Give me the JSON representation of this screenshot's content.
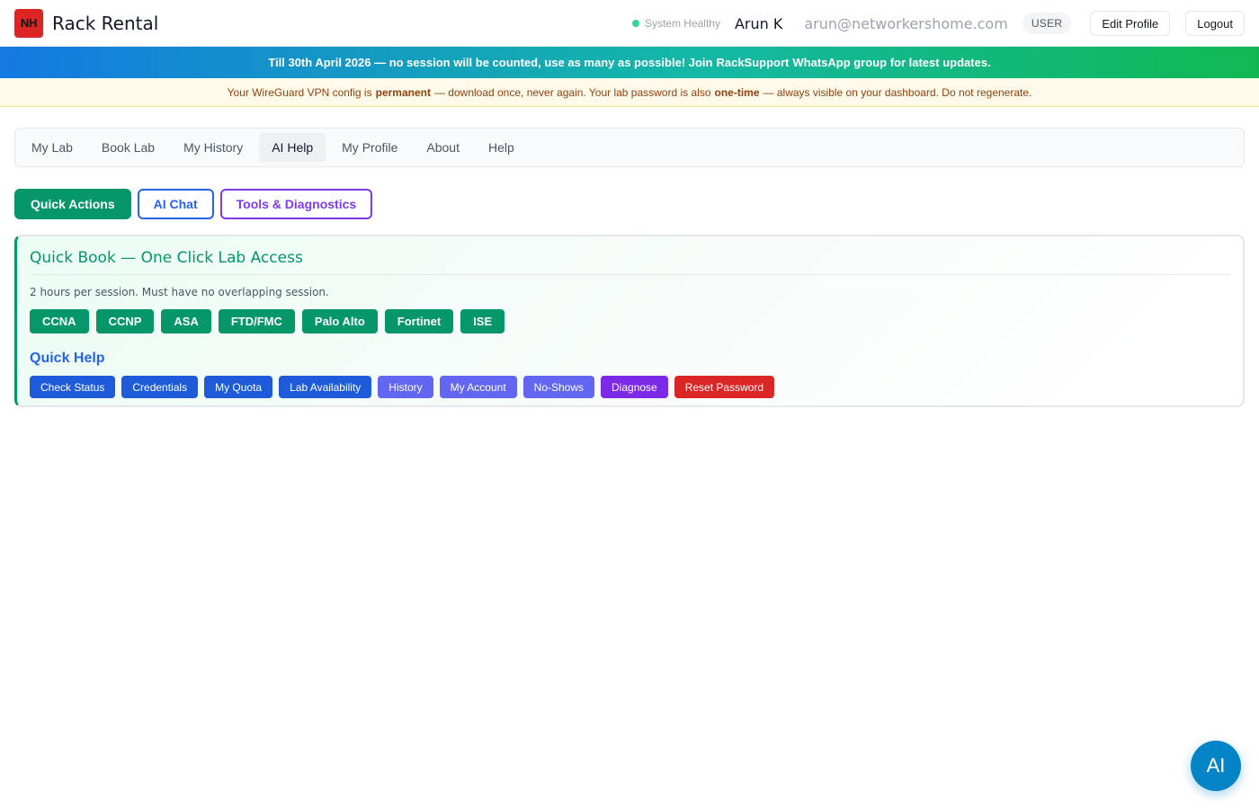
{
  "header": {
    "logo_text": "NH",
    "app_title": "Rack Rental",
    "status_text": "System Healthy",
    "user_name": "Arun K",
    "user_email": "arun@networkershome.com",
    "role": "USER",
    "edit_profile_label": "Edit Profile",
    "logout_label": "Logout"
  },
  "promo_banner": {
    "text_before": "Till 30th April 2026 — no session will be counted, use as many as possible! Join",
    "bold": "RackSupport",
    "text_after": "WhatsApp group for latest updates."
  },
  "notice_banner": {
    "part1": "Your WireGuard VPN config is",
    "bold1": "permanent",
    "part2": "— download once, never again. Your lab password is also",
    "bold2": "one-time",
    "part3": "— always visible on your dashboard. Do not regenerate."
  },
  "nav": {
    "tabs": [
      {
        "label": "My Lab"
      },
      {
        "label": "Book Lab"
      },
      {
        "label": "My History"
      },
      {
        "label": "AI Help",
        "active": true
      },
      {
        "label": "My Profile"
      },
      {
        "label": "About"
      },
      {
        "label": "Help"
      }
    ]
  },
  "subtabs": {
    "quick_actions": "Quick Actions",
    "ai_chat": "AI Chat",
    "tools": "Tools & Diagnostics"
  },
  "quick_book": {
    "title": "Quick Book — One Click Lab Access",
    "subtitle": "2 hours per session. Must have no overlapping session.",
    "labs": [
      "CCNA",
      "CCNP",
      "ASA",
      "FTD/FMC",
      "Palo Alto",
      "Fortinet",
      "ISE"
    ]
  },
  "quick_help": {
    "title": "Quick Help",
    "buttons": [
      {
        "label": "Check Status",
        "color": "#1d5bdb"
      },
      {
        "label": "Credentials",
        "color": "#1d5bdb"
      },
      {
        "label": "My Quota",
        "color": "#1d5bdb"
      },
      {
        "label": "Lab Availability",
        "color": "#1d5bdb"
      },
      {
        "label": "History",
        "color": "#6366f1"
      },
      {
        "label": "My Account",
        "color": "#6366f1"
      },
      {
        "label": "No-Shows",
        "color": "#6366f1"
      },
      {
        "label": "Diagnose",
        "color": "#7c2ae8"
      },
      {
        "label": "Reset Password",
        "color": "#dc2626"
      }
    ]
  },
  "fab": {
    "label": "AI"
  },
  "colors": {
    "accent_green": "#059669",
    "accent_blue": "#2563eb",
    "accent_purple": "#7c3aed",
    "danger": "#dc2626"
  }
}
